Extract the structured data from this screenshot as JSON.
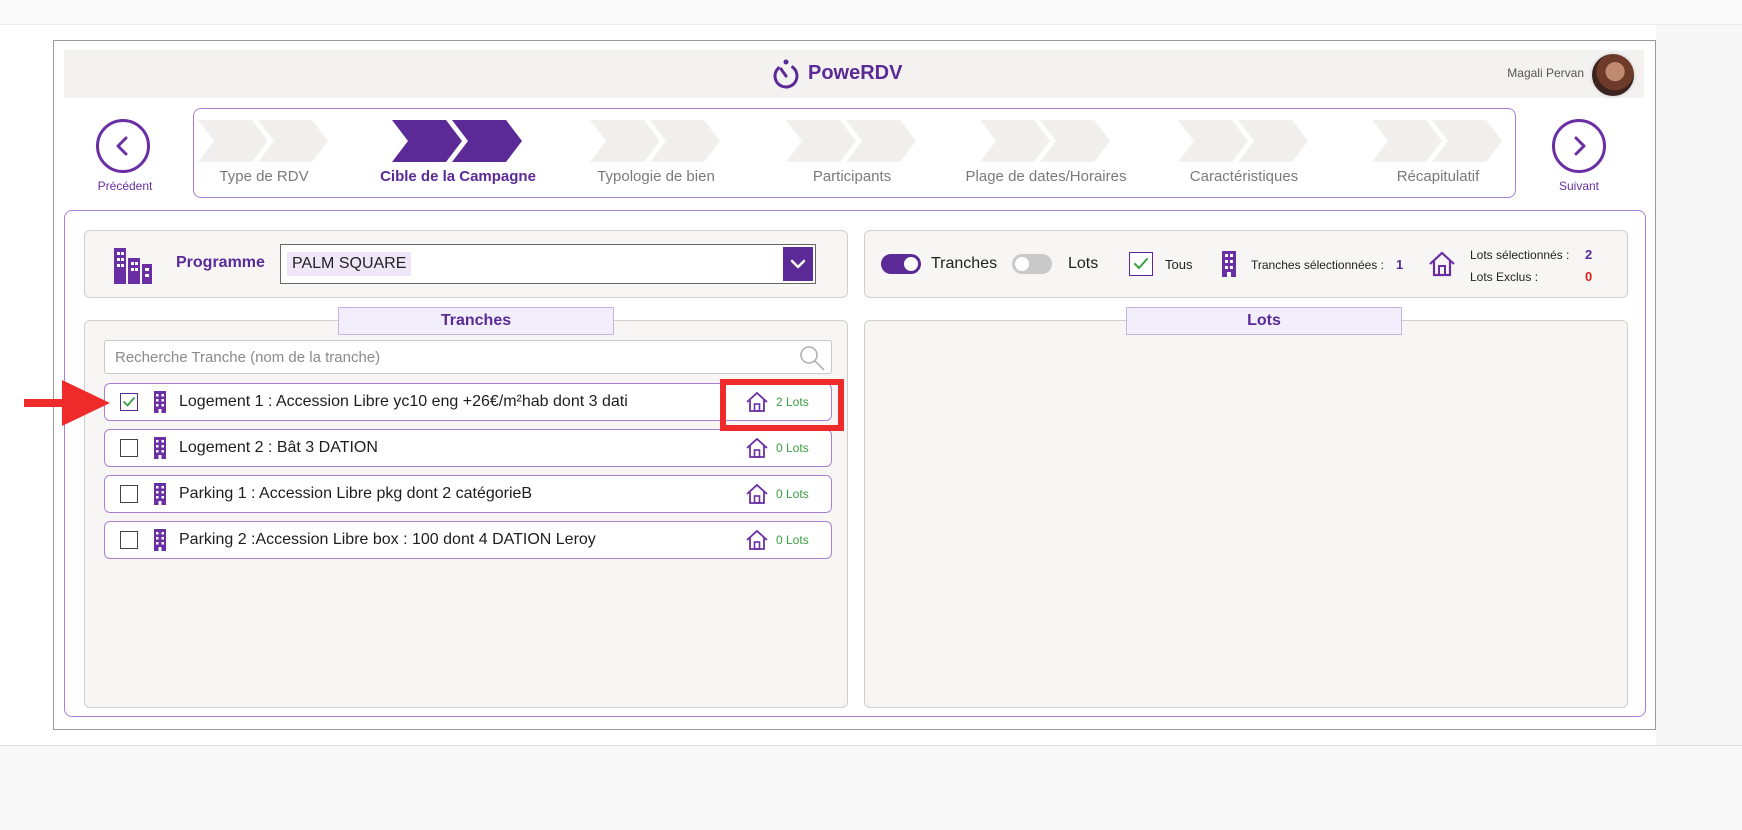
{
  "app": {
    "title": "PoweRDV",
    "user_name": "Magali Pervan"
  },
  "nav": {
    "prev_label": "Précédent",
    "next_label": "Suivant"
  },
  "steps": [
    {
      "label": "Type de RDV",
      "active": false
    },
    {
      "label": "Cible de la Campagne",
      "active": true
    },
    {
      "label": "Typologie de bien",
      "active": false
    },
    {
      "label": "Participants",
      "active": false
    },
    {
      "label": "Plage de dates/Horaires",
      "active": false
    },
    {
      "label": "Caractéristiques",
      "active": false
    },
    {
      "label": "Récapitulatif",
      "active": false
    }
  ],
  "program": {
    "label": "Programme",
    "value": "PALM SQUARE"
  },
  "filters": {
    "tranches_label": "Tranches",
    "tranches_on": true,
    "lots_label": "Lots",
    "lots_on": false,
    "tous_label": "Tous",
    "tous_checked": true,
    "tranches_selected_label": "Tranches sélectionnées :",
    "tranches_selected_count": "1",
    "lots_selected_label": "Lots sélectionnés :",
    "lots_selected_count": "2",
    "lots_excluded_label": "Lots Exclus :",
    "lots_excluded_count": "0"
  },
  "tranches_panel": {
    "header": "Tranches",
    "search_placeholder": "Recherche Tranche (nom de la tranche)",
    "rows": [
      {
        "name": "Logement 1 : Accession Libre yc10 eng +26€/m²hab dont 3 dati",
        "lots": "2 Lots",
        "checked": true
      },
      {
        "name": "Logement 2 : Bât 3 DATION",
        "lots": "0 Lots",
        "checked": false
      },
      {
        "name": "Parking 1 : Accession Libre pkg dont 2 catégorieB",
        "lots": "0 Lots",
        "checked": false
      },
      {
        "name": "Parking 2 :Accession Libre box : 100 dont 4 DATION Leroy",
        "lots": "0 Lots",
        "checked": false
      }
    ]
  },
  "lots_panel": {
    "header": "Lots"
  },
  "colors": {
    "accent": "#5b2a96",
    "highlight": "#ef2a2a",
    "lots_count": "#3aa040"
  },
  "icons": [
    "logo-icon",
    "chevron-left-icon",
    "chevron-right-icon",
    "buildings-icon",
    "chevron-down-icon",
    "building-icon",
    "house-icon",
    "search-icon",
    "check-icon",
    "arrow-icon"
  ]
}
